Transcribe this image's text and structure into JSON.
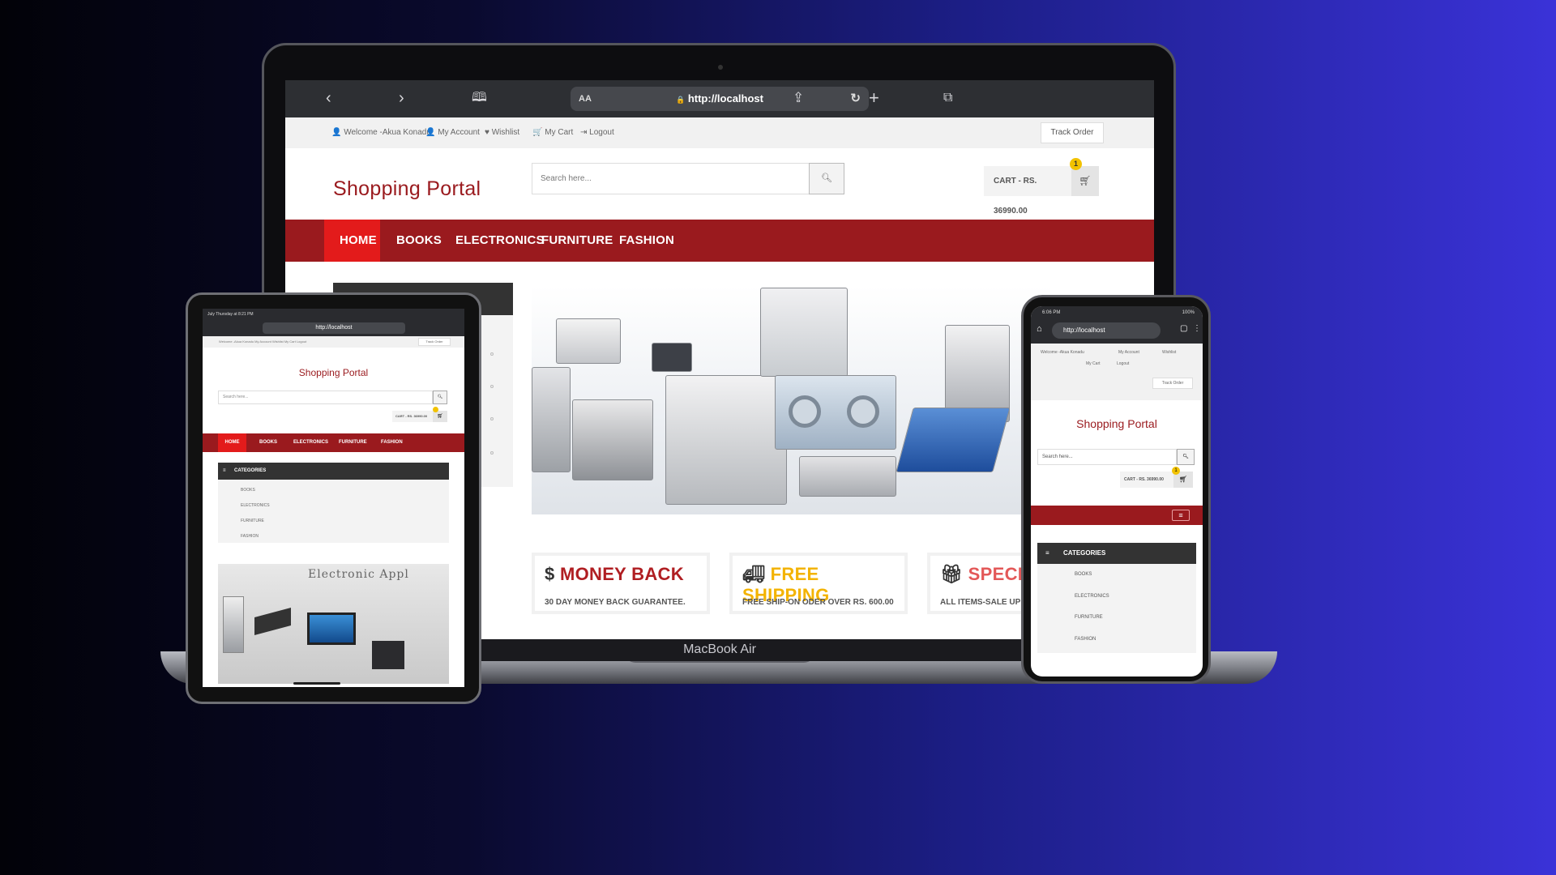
{
  "laptop": {
    "model_label": "MacBook Air",
    "browser": {
      "url": "http://localhost",
      "aa_label": "AA",
      "icons": [
        "chevron-left-icon",
        "chevron-right-icon",
        "book-icon",
        "reload-icon",
        "share-icon",
        "plus-icon",
        "tabs-icon"
      ]
    },
    "top_links": {
      "welcome": "Welcome -Akua Konadu",
      "my_account": "My Account",
      "wishlist": "Wishlist",
      "my_cart": "My Cart",
      "logout": "Logout",
      "track_order": "Track Order"
    },
    "header": {
      "logo": "Shopping Portal",
      "search_placeholder": "Search here...",
      "cart_label": "CART - RS. 36990.00",
      "cart_count": "1"
    },
    "nav": {
      "items": [
        "HOME",
        "BOOKS",
        "ELECTRONICS",
        "FURNITURE",
        "FASHION"
      ],
      "active_index": 0
    },
    "info_boxes": [
      {
        "title": "MONEY BACK",
        "subtitle": "30 DAY MONEY BACK GUARANTEE.",
        "icon": "dollar-icon",
        "color": "#b01e22"
      },
      {
        "title": "FREE SHIPPING",
        "subtitle": "FREE SHIP-ON ODER OVER RS. 600.00",
        "icon": "truck-icon",
        "color": "#f3b300"
      },
      {
        "title": "SPECIA",
        "subtitle": "ALL ITEMS-SALE UP",
        "icon": "gift-icon",
        "color": "#e35858"
      }
    ]
  },
  "tablet": {
    "status_time": "July Thursday at 8:21 PM",
    "url": "http://localhost",
    "top_links": "Welcome -Akua Konadu   My Account   Wishlist   My Cart   Logout",
    "track_order": "Track Order",
    "logo": "Shopping Portal",
    "search_placeholder": "Search here...",
    "cart_label": "CART - RS. 36990.00",
    "nav": [
      "HOME",
      "BOOKS",
      "ELECTRONICS",
      "FURNITURE",
      "FASHION"
    ],
    "categories_title": "CATEGORIES",
    "categories": [
      "BOOKS",
      "ELECTRONICS",
      "FURNITURE",
      "FASHION"
    ],
    "banner_title": "Electronic Appl"
  },
  "phone": {
    "status_time": "6:06 PM",
    "status_battery": "100%",
    "url": "http://localhost",
    "welcome": "Welcome -Akua Konadu",
    "my_account": "My Account",
    "wishlist": "Wishlist",
    "my_cart": "My Cart",
    "logout": "Logout",
    "track_order": "Track Order",
    "logo": "Shopping Portal",
    "search_placeholder": "Search here...",
    "cart_label": "CART - RS. 36990.00",
    "cart_count": "1",
    "categories_title": "CATEGORIES",
    "categories": [
      "BOOKS",
      "ELECTRONICS",
      "FURNITURE",
      "FASHION"
    ]
  },
  "colors": {
    "brand_red": "#9a1a1e",
    "active_red": "#e31b1b",
    "badge_yellow": "#f2c200",
    "bg_blue": "#3a32d8"
  }
}
